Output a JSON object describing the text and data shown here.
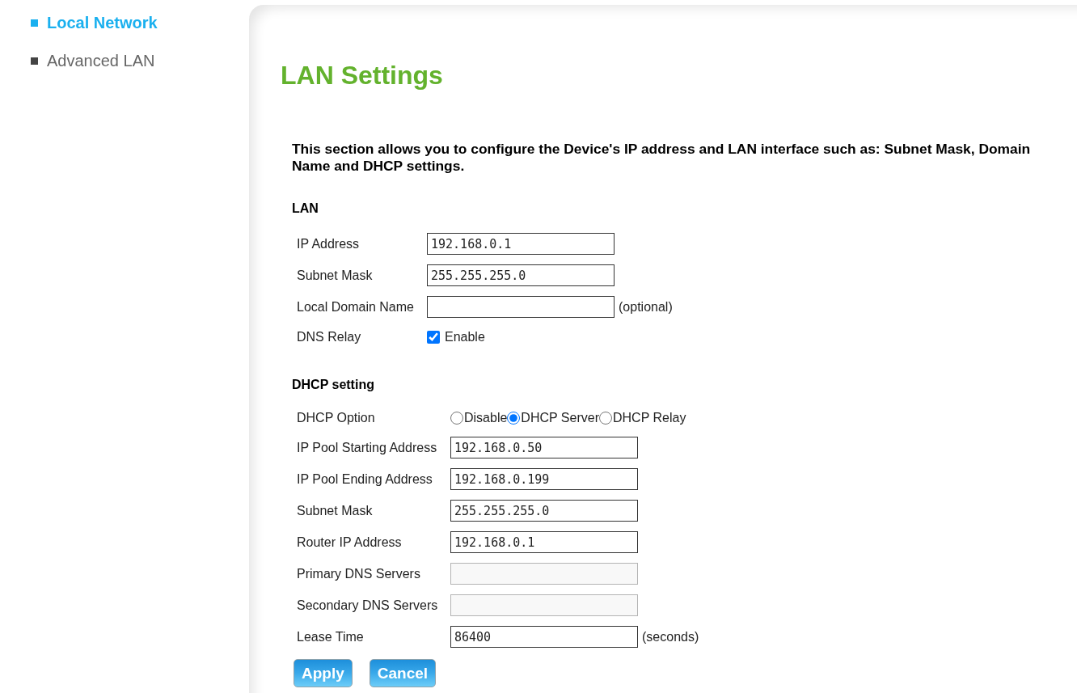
{
  "sidebar": {
    "items": [
      {
        "label": "Local Network",
        "selected": true
      },
      {
        "label": "Advanced LAN",
        "selected": false
      }
    ]
  },
  "page": {
    "title": "LAN Settings",
    "description": "This section allows you to configure the Device's IP address and LAN interface such as: Subnet Mask, Domain Name and DHCP settings."
  },
  "lan": {
    "heading": "LAN",
    "fields": [
      {
        "kind": "text",
        "label": "IP Address",
        "value": "192.168.0.1",
        "disabled": false
      },
      {
        "kind": "text",
        "label": "Subnet Mask",
        "value": "255.255.255.0",
        "disabled": false
      },
      {
        "kind": "text",
        "label": "Local Domain Name",
        "note": "(optional)",
        "disabled": false
      },
      {
        "kind": "checkbox",
        "label": "DNS Relay",
        "option": "Enable",
        "checked": true
      }
    ]
  },
  "dhcp": {
    "heading": "DHCP setting",
    "fields": [
      {
        "kind": "radio",
        "label": "DHCP Option",
        "options": [
          {
            "label": "Disable",
            "selected": false
          },
          {
            "label": "DHCP Server",
            "selected": true
          },
          {
            "label": "DHCP Relay",
            "selected": false
          }
        ]
      },
      {
        "kind": "text",
        "label": "IP Pool Starting Address",
        "value": "192.168.0.50",
        "disabled": false
      },
      {
        "kind": "text",
        "label": "IP Pool Ending Address",
        "value": "192.168.0.199",
        "disabled": false
      },
      {
        "kind": "text",
        "label": "Subnet Mask",
        "value": "255.255.255.0",
        "disabled": false
      },
      {
        "kind": "text",
        "label": "Router IP Address",
        "value": "192.168.0.1",
        "disabled": false
      },
      {
        "kind": "text",
        "label": "Primary DNS Servers",
        "disabled": true
      },
      {
        "kind": "text",
        "label": "Secondary DNS Servers",
        "disabled": true
      },
      {
        "kind": "text",
        "label": "Lease Time",
        "value": "86400",
        "note": "(seconds)",
        "disabled": false
      }
    ]
  },
  "buttons": [
    {
      "label": "Apply"
    },
    {
      "label": "Cancel"
    }
  ]
}
